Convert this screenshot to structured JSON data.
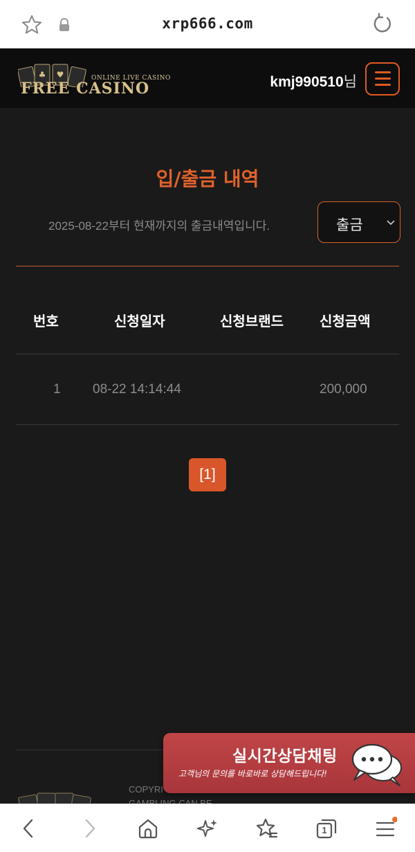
{
  "browser": {
    "url": "xrp666.com",
    "icons": [
      "star-icon",
      "lock-icon",
      "reload-icon"
    ]
  },
  "header": {
    "logo_sub": "ONLINE LIVE CASINO",
    "logo_main": "FREE CASINO",
    "username": "kmj990510",
    "username_suffix": "님"
  },
  "main": {
    "title": "입/출금 내역",
    "since_text": "2025-08-22부터 현재까지의 출금내역입니다.",
    "select_value": "출금",
    "table": {
      "headers": [
        "번호",
        "신청일자",
        "신청브랜드",
        "신청금액"
      ],
      "rows": [
        {
          "no": "1",
          "date": "08-22 14:14:44",
          "brand": "",
          "amount": "200,000"
        }
      ]
    },
    "pagination": "[1]"
  },
  "footer": {
    "copyright_line1": "COPYRI",
    "copyright_line2": "GAMBLING CAN BE"
  },
  "chat_banner": {
    "title": "실시간상담채팅",
    "subtitle": "고객님의 문의를 바로바로 상담해드립니다!"
  },
  "colors": {
    "accent": "#e0622c",
    "background": "#1a1a1a",
    "header_bg": "#0d0d0d",
    "chat_banner": "#b03d41"
  },
  "bottom_nav": {
    "icons": [
      "back-icon",
      "forward-icon",
      "home-icon",
      "sparkle-icon",
      "bookmarks-icon",
      "tabs-icon",
      "menu-icon"
    ],
    "tabs_count": "1"
  }
}
